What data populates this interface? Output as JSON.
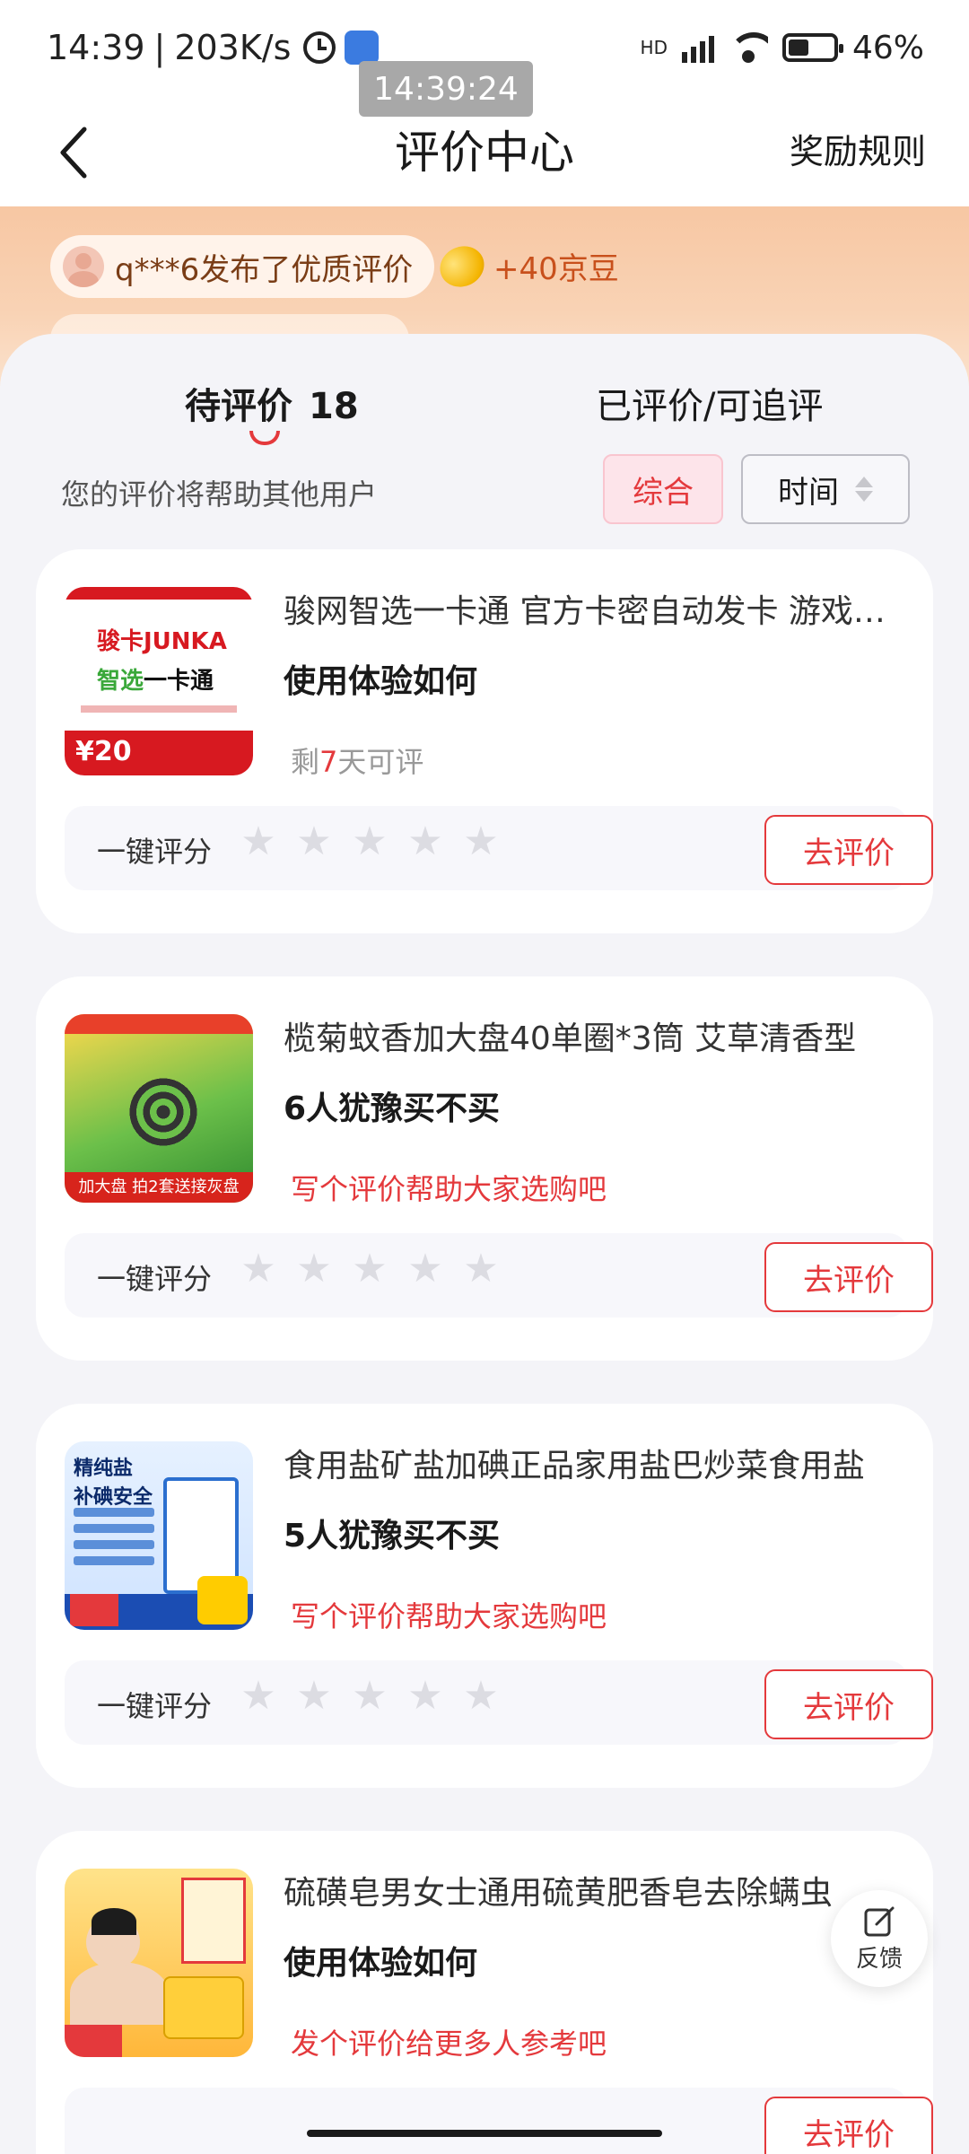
{
  "status": {
    "time": "14:39",
    "speed": "203K/s",
    "network": "HD",
    "battery": "46%",
    "time_overlay": "14:39:24"
  },
  "header": {
    "title": "评价中心",
    "rules": "奖励规则"
  },
  "banner": {
    "feed_text": "q***6发布了优质评价",
    "reward": "+40京豆"
  },
  "tabs": {
    "pending_label": "待评价",
    "pending_count": "18",
    "done_label": "已评价/可追评"
  },
  "filter": {
    "hint": "您的评价将帮助其他用户",
    "combined": "综合",
    "time": "时间"
  },
  "rating_label": "一键评分",
  "review_button": "去评价",
  "products": [
    {
      "title": "骏网智选一卡通 官方卡密自动发卡 游戏充值",
      "subtitle": "使用体验如何",
      "note_prefix": "剩",
      "note_days": "7",
      "note_suffix": "天可评",
      "thumb": {
        "brand": "骏卡JUNKA",
        "line2_a": "智选",
        "line2_b": "一卡通",
        "price": "¥20"
      }
    },
    {
      "title": "榄菊蚊香加大盘40单圈*3筒 艾草清香型",
      "subtitle": "6人犹豫买不买",
      "note": "写个评价帮助大家选购吧",
      "thumb": {
        "banner": "加大盘 拍2套送接灰盘"
      }
    },
    {
      "title": "食用盐矿盐加碘正品家用盐巴炒菜食用盐",
      "subtitle": "5人犹豫买不买",
      "note": "写个评价帮助大家选购吧",
      "thumb": {
        "line1": "精纯盐",
        "line2": "补碘安全"
      }
    },
    {
      "title": "硫磺皂男女士通用硫黄肥香皂去除螨虫",
      "subtitle": "使用体验如何",
      "note": "发个评价给更多人参考吧"
    }
  ],
  "feedback": "反馈",
  "colors": {
    "accent": "#e4393c",
    "banner": "#f7c7a3"
  }
}
